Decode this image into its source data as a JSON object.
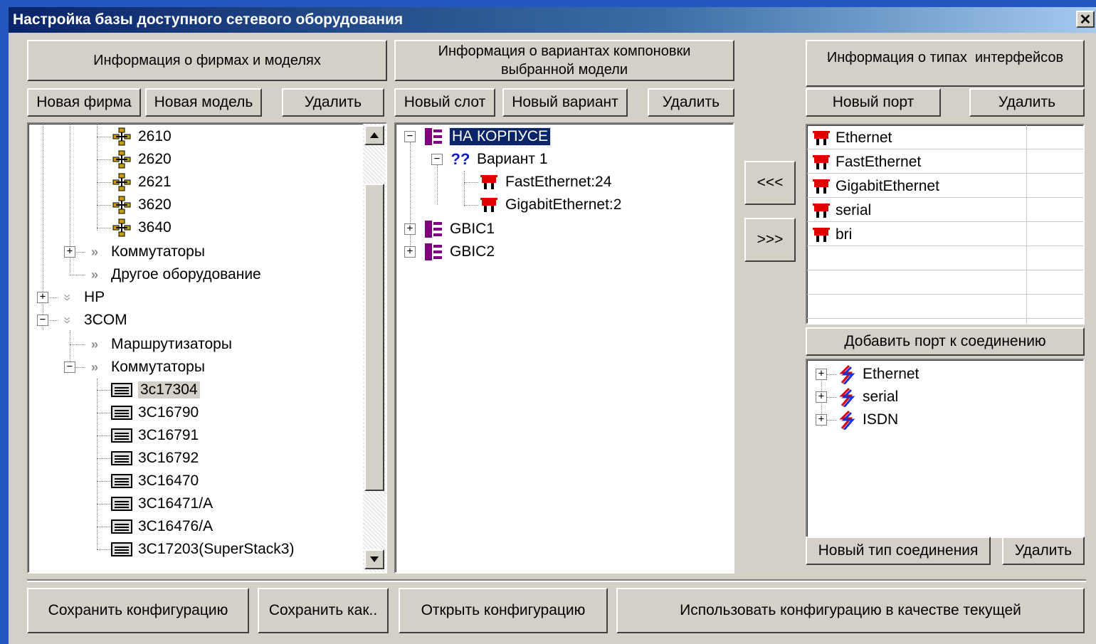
{
  "window": {
    "title": "Настройка базы доступного сетевого оборудования",
    "close_label": "✕"
  },
  "left_panel": {
    "header": "Информация о фирмах и моделях",
    "buttons": {
      "new_firm": "Новая фирма",
      "new_model": "Новая модель",
      "delete": "Удалить"
    },
    "tree": [
      {
        "label": "2610",
        "icon": "router-icon"
      },
      {
        "label": "2620",
        "icon": "router-icon"
      },
      {
        "label": "2621",
        "icon": "router-icon"
      },
      {
        "label": "3620",
        "icon": "router-icon"
      },
      {
        "label": "3640",
        "icon": "router-icon"
      },
      {
        "label": "Коммутаторы",
        "icon": "category-icon"
      },
      {
        "label": "Другое оборудование",
        "icon": "category-icon"
      },
      {
        "label": "HP",
        "icon": "firm-icon"
      },
      {
        "label": "3COM",
        "icon": "firm-icon"
      },
      {
        "label": "Маршрутизаторы",
        "icon": "category-icon"
      },
      {
        "label": "Коммутаторы",
        "icon": "category-icon"
      },
      {
        "label": "3c17304",
        "icon": "switch-icon"
      },
      {
        "label": "3C16790",
        "icon": "switch-icon"
      },
      {
        "label": "3C16791",
        "icon": "switch-icon"
      },
      {
        "label": "3C16792",
        "icon": "switch-icon"
      },
      {
        "label": "3C16470",
        "icon": "switch-icon"
      },
      {
        "label": "3C16471/A",
        "icon": "switch-icon"
      },
      {
        "label": "3C16476/A",
        "icon": "switch-icon"
      },
      {
        "label": "3C17203(SuperStack3)",
        "icon": "switch-icon"
      }
    ]
  },
  "middle_panel": {
    "header": "Информация о вариантах компоновки выбранной модели",
    "buttons": {
      "new_slot": "Новый слот",
      "new_variant": "Новый вариант",
      "delete": "Удалить"
    },
    "tree": [
      {
        "label": "НА КОРПУСЕ",
        "icon": "slot-icon"
      },
      {
        "label": "Вариант 1",
        "icon": "variant-icon",
        "icon_text": "??"
      },
      {
        "label": "FastEthernet:24",
        "icon": "port-icon"
      },
      {
        "label": "GigabitEthernet:2",
        "icon": "port-icon"
      },
      {
        "label": "GBIC1",
        "icon": "slot-icon"
      },
      {
        "label": "GBIC2",
        "icon": "slot-icon"
      }
    ]
  },
  "transfer_buttons": {
    "add": "<<<",
    "remove": ">>>"
  },
  "right_panel": {
    "header": "Информация о типах  интерфейсов",
    "buttons": {
      "new_port": "Новый порт",
      "delete": "Удалить",
      "add_port_to_connection": "Добавить порт к соединению",
      "new_connection_type": "Новый тип соединения",
      "delete_connection": "Удалить"
    },
    "ports": [
      "Ethernet",
      "FastEthernet",
      "GigabitEthernet",
      "serial",
      "bri"
    ],
    "connections": [
      "Ethernet",
      "serial",
      "ISDN"
    ]
  },
  "bottom_buttons": {
    "save": "Сохранить конфигурацию",
    "save_as": "Сохранить как..",
    "open": "Открыть конфигурацию",
    "use_current": "Использовать конфигурацию в качестве текущей"
  },
  "colors": {
    "title_bar": "#0a246a",
    "selection": "#0a246a",
    "port_icon": "#e00000",
    "slot_icon": "#800080",
    "connection_icon_red": "#e00000",
    "connection_icon_blue": "#2030d0",
    "desktop": "#2457c0",
    "face": "#d4d0c8"
  }
}
